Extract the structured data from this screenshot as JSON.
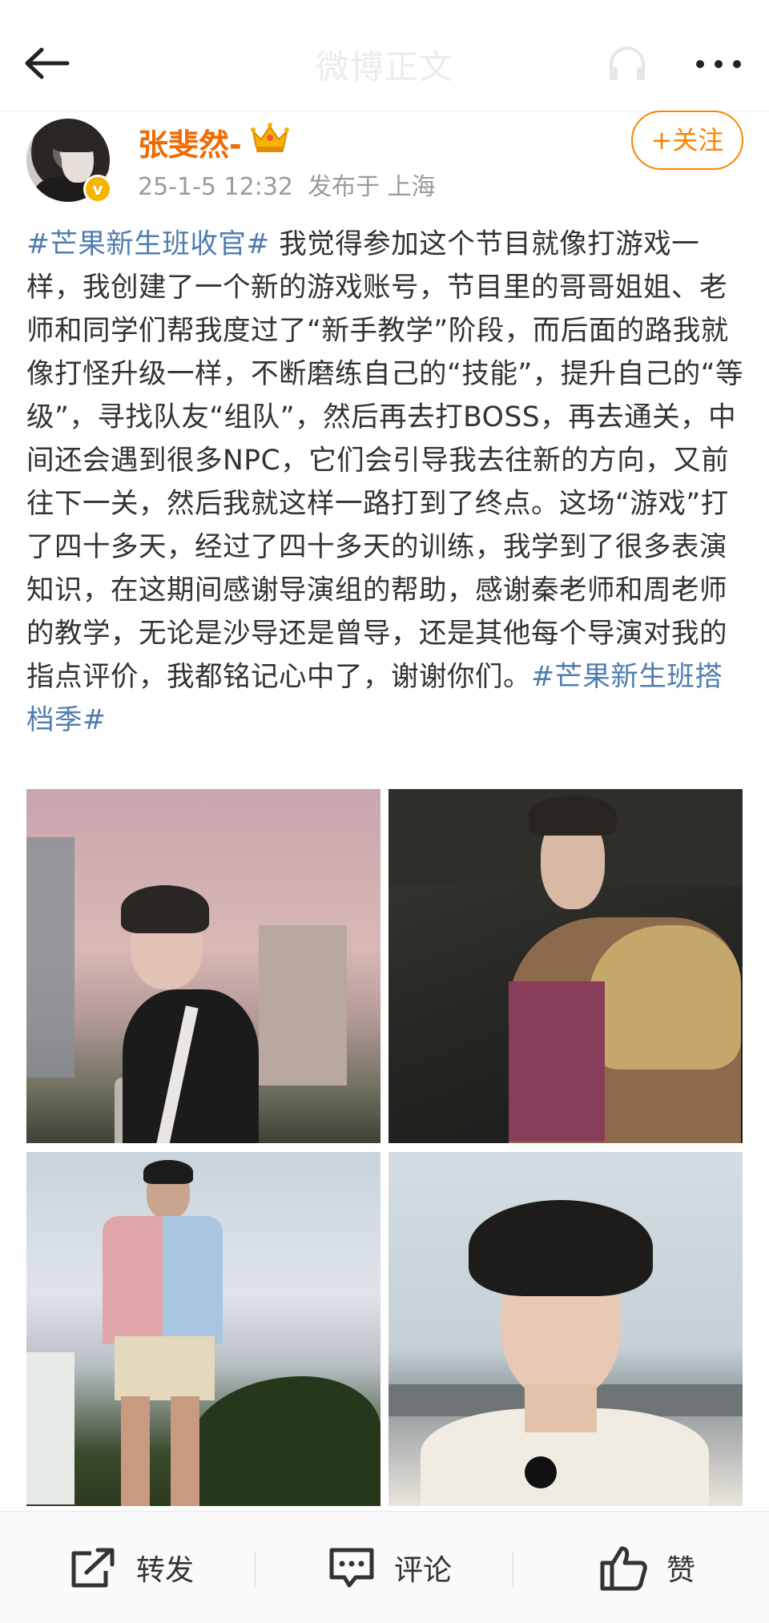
{
  "header": {
    "title": "微博正文",
    "back_icon": "arrow-left-icon",
    "listen_icon": "headphones-icon",
    "more_icon": "more-dots-icon"
  },
  "user": {
    "name": "张斐然-",
    "badge_icon": "crown-icon",
    "verified_icon": "verified-badge-icon",
    "date": "25-1-5 12:32",
    "location": "发布于 上海",
    "follow_label": "+关注"
  },
  "post": {
    "hashtag1": "#芒果新生班收官#",
    "body": " 我觉得参加这个节目就像打游戏一样，我创建了一个新的游戏账号，节目里的哥哥姐姐、老师和同学们帮我度过了“新手教学”阶段，而后面的路我就像打怪升级一样，不断磨练自己的“技能”，提升自己的“等级”，寻找队友“组队”，然后再去打BOSS，再去通关，中间还会遇到很多NPC，它们会引导我去往新的方向，又前往下一关，然后我就这样一路打到了终点。这场“游戏”打了四十多天，经过了四十多天的训练，我学到了很多表演知识，在这期间感谢导演组的帮助，感谢秦老师和周老师的教学，无论是沙导还是曾导，还是其他每个导演对我的指点评价，我都铭记心中了，谢谢你们。",
    "hashtag2": "#芒果新生班搭档季#"
  },
  "actions": {
    "repost_label": "转发",
    "comment_label": "评论",
    "like_label": "赞"
  },
  "colors": {
    "username": "#f26a00",
    "hashtag": "#507daf",
    "follow": "#ff8200",
    "meta": "#9b9b9b"
  }
}
